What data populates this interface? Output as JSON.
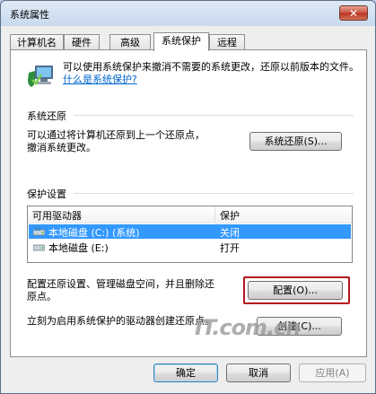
{
  "window": {
    "title": "系统属性",
    "close_label": "✕"
  },
  "tabs": [
    {
      "label": "计算机名",
      "active": false
    },
    {
      "label": "硬件",
      "active": false
    },
    {
      "label": "高级",
      "active": false
    },
    {
      "label": "系统保护",
      "active": true
    },
    {
      "label": "远程",
      "active": false
    }
  ],
  "intro": {
    "text": "可以使用系统保护来撤消不需要的系统更改，还原以前版本的文件。",
    "link": "什么是系统保护?"
  },
  "restore": {
    "group_label": "系统还原",
    "description_line1": "可以通过将计算机还原到上一个还原点，",
    "description_line2": "撤消系统更改。",
    "button": "系统还原(S)..."
  },
  "protection": {
    "group_label": "保护设置",
    "columns": [
      "可用驱动器",
      "保护"
    ],
    "rows": [
      {
        "drive": "本地磁盘 (C:) (系统)",
        "protection": "关闭",
        "selected": true
      },
      {
        "drive": "本地磁盘 (E:)",
        "protection": "打开",
        "selected": false
      }
    ],
    "configure_text_line1": "配置还原设置、管理磁盘空间，并且删除还",
    "configure_text_line2": "原点。",
    "configure_button": "配置(O)...",
    "create_text": "立刻为启用系统保护的驱动器创建还原点。",
    "create_button": "创建(C)..."
  },
  "footer": {
    "ok": "确定",
    "cancel": "取消",
    "apply": "应用(A)"
  },
  "watermark": "IT.com.cn",
  "colors": {
    "selection": "#3399ff",
    "highlight_box": "#b4141e",
    "link": "#0066cc"
  }
}
